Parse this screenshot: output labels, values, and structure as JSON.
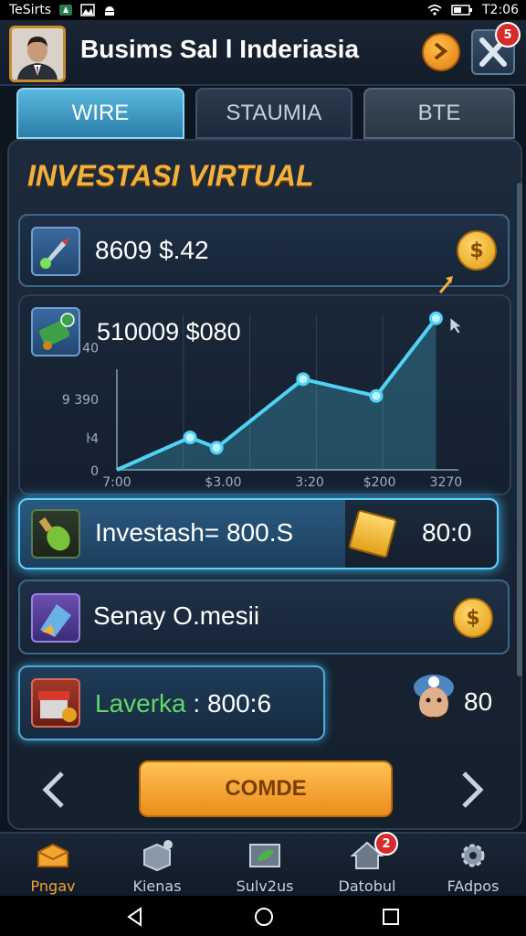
{
  "status_bar": {
    "carrier": "TeSirts",
    "time": "T2:06"
  },
  "header": {
    "title": "Busims Sal l Inderiasia",
    "close_badge_count": "5"
  },
  "tabs": [
    {
      "label": "WIRE",
      "active": true
    },
    {
      "label": "STAUMIA",
      "active": false
    },
    {
      "label": "BTE",
      "active": false
    }
  ],
  "section_title": "INVESTASI VIRTUAL",
  "balance_row": {
    "value": "8609 $.42",
    "coin_icon": "dollar-coin"
  },
  "chart_data": {
    "type": "line",
    "title": "510009 $080",
    "y_tick_labels": [
      "0",
      "ŀ4",
      "9 390",
      "40"
    ],
    "x_tick_labels": [
      "7:00",
      "$3.00",
      "3:20",
      "$200",
      "3270"
    ],
    "values": [
      {
        "x": 0.22,
        "y": 0.25
      },
      {
        "x": 0.3,
        "y": 0.17
      },
      {
        "x": 0.56,
        "y": 0.7
      },
      {
        "x": 0.78,
        "y": 0.57
      },
      {
        "x": 0.96,
        "y": 1.17
      }
    ],
    "color": "#4fd2f5"
  },
  "invest_row": {
    "label": "Investash= 800.S",
    "amount": "80:0"
  },
  "senay_row": {
    "label": "Senay O.mesii"
  },
  "laverka_row": {
    "label": "Laverka",
    "value": ": 800:6",
    "side_amount": "80",
    "label_color": "#62d865"
  },
  "combo_button": {
    "label": "COMDE"
  },
  "bottom_nav": [
    {
      "label": "Pngav",
      "icon": "chest-icon",
      "color": "#f3a530"
    },
    {
      "label": "Kienas",
      "icon": "cube-icon",
      "color": "#c6d2de"
    },
    {
      "label": "Sulv2us",
      "icon": "leaf-card-icon",
      "color": "#c6d2de"
    },
    {
      "label": "Datobul",
      "icon": "house-icon",
      "color": "#c6d2de",
      "badge": "2"
    },
    {
      "label": "FAdpos",
      "icon": "gear-icon",
      "color": "#c6d2de"
    }
  ]
}
